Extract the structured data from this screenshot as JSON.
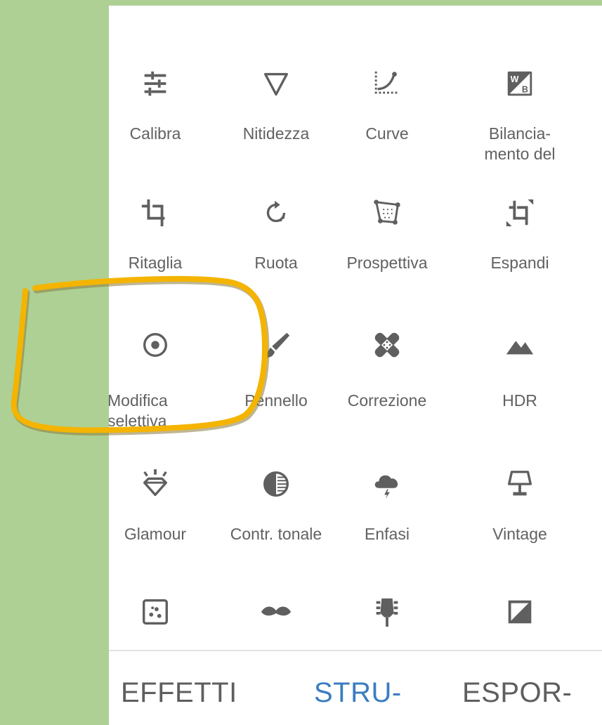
{
  "tools": [
    {
      "label": "Calibra",
      "icon": "tune-sliders-icon"
    },
    {
      "label": "Nitidezza",
      "icon": "sharpen-triangle-icon"
    },
    {
      "label": "Curve",
      "icon": "curves-icon"
    },
    {
      "label": "Bilancia-\nmento del",
      "icon": "white-balance-icon"
    },
    {
      "label": "Ritaglia",
      "icon": "crop-icon"
    },
    {
      "label": "Ruota",
      "icon": "rotate-icon"
    },
    {
      "label": "Prospettiva",
      "icon": "perspective-icon"
    },
    {
      "label": "Espandi",
      "icon": "expand-icon"
    },
    {
      "label": "Modifica\nselettiva",
      "icon": "selective-target-icon"
    },
    {
      "label": "Pennello",
      "icon": "brush-icon"
    },
    {
      "label": "Correzione",
      "icon": "healing-bandage-icon"
    },
    {
      "label": "HDR",
      "icon": "mountains-icon"
    },
    {
      "label": "Glamour",
      "icon": "diamond-glow-icon"
    },
    {
      "label": "Contr. tonale",
      "icon": "tonal-contrast-icon"
    },
    {
      "label": "Enfasi",
      "icon": "cloud-storm-icon"
    },
    {
      "label": "Vintage",
      "icon": "lamp-icon"
    },
    {
      "label": "",
      "icon": "grainy-dice-icon"
    },
    {
      "label": "",
      "icon": "mustache-icon"
    },
    {
      "label": "",
      "icon": "guitar-head-icon"
    },
    {
      "label": "",
      "icon": "noir-frame-icon"
    }
  ],
  "tabs": {
    "effects": "EFFETTI",
    "tools": "STRU-",
    "export": "ESPOR-"
  },
  "colors": {
    "background_green": "#aed094",
    "icon_gray": "#5f5f5f",
    "active_tab": "#3c7cc1",
    "highlight_marker": "#f4b400"
  }
}
